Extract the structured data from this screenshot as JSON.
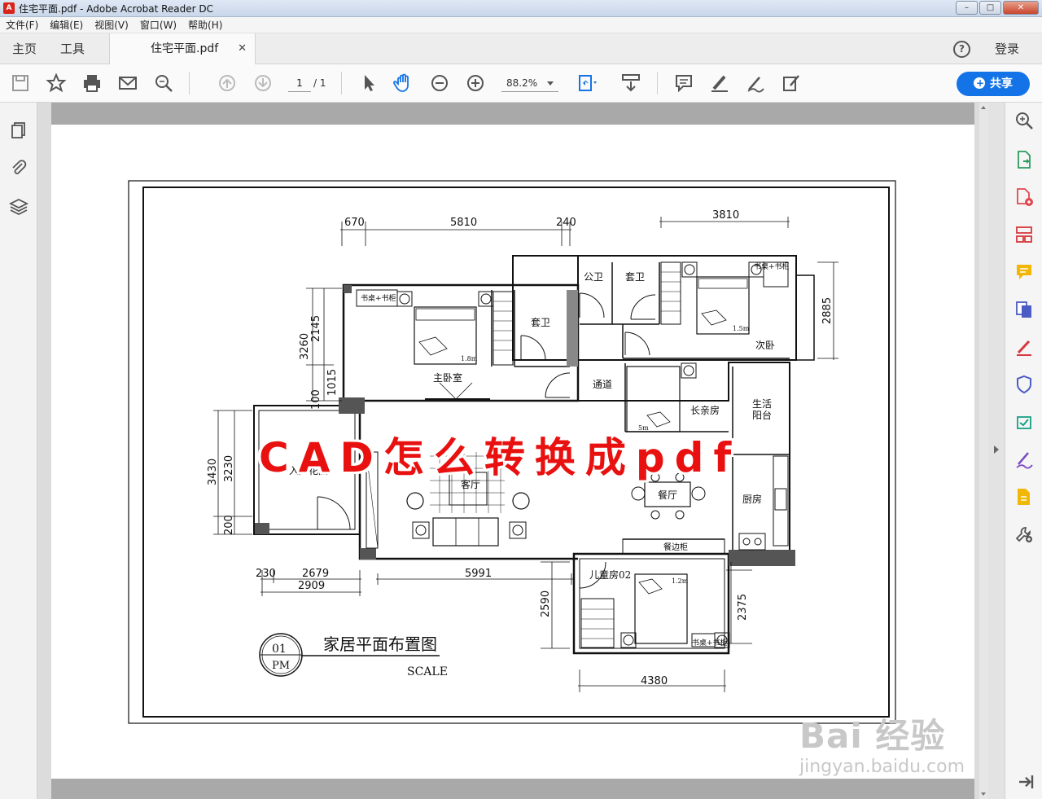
{
  "window": {
    "title": "住宅平面.pdf - Adobe Acrobat Reader DC",
    "min": "–",
    "max": "□",
    "close": "✕"
  },
  "menu": [
    "文件(F)",
    "编辑(E)",
    "视图(V)",
    "窗口(W)",
    "帮助(H)"
  ],
  "tabs": {
    "home": "主页",
    "tools": "工具",
    "document": "住宅平面.pdf",
    "close": "✕",
    "help": "?",
    "login": "登录"
  },
  "toolbar": {
    "page_current": "1",
    "page_total": "/ 1",
    "zoom": "88.2%",
    "share": "共享"
  },
  "left_icons": [
    "pages-icon",
    "attachment-icon",
    "layers-icon"
  ],
  "right_icons": [
    "zoom-icon",
    "export-pdf-icon",
    "create-pdf-icon",
    "organize-pages-icon",
    "comment-icon",
    "combine-files-icon",
    "fill-sign-icon",
    "protect-icon",
    "send-for-review-icon",
    "sign-icon",
    "edit-pdf-icon",
    "more-tools-icon"
  ],
  "drawing": {
    "title": "家居平面布置图",
    "scale": "SCALE",
    "badge_top": "01",
    "badge_bottom": "PM",
    "dims": {
      "d670": "670",
      "d5810": "5810",
      "d240": "240",
      "d3810": "3810",
      "d2885": "2885",
      "d3260": "3260",
      "d2145": "2145",
      "d1015": "1015",
      "d100": "100",
      "d3430": "3430",
      "d3230": "3230",
      "d200": "200",
      "d230": "230",
      "d2679": "2679",
      "d2909": "2909",
      "d5991": "5991",
      "d2590": "2590",
      "d2375": "2375",
      "d4380": "4380"
    },
    "rooms": {
      "gongwei": "公卫",
      "taowei1": "套卫",
      "taowei2": "套卫",
      "shuzhuo1": "书桌+书柜",
      "shuzhuo2": "书桌+书柜",
      "shuzhuo3": "书桌+书柜",
      "bed18": "1.8m",
      "bed15": "1.5m",
      "bed15b": "5m",
      "master": "主卧室",
      "second": "次卧",
      "corridor": "通道",
      "elder": "长亲房",
      "balcony1": "生活",
      "balcony2": "阳台",
      "garden": "入户花园",
      "living": "客厅",
      "dining": "餐厅",
      "kitchen": "厨房",
      "sideboard": "餐边柜",
      "child": "儿童房02",
      "bed1": "1.2m"
    }
  },
  "overlay_text": "CAD怎么转换成pdf",
  "watermark": {
    "line1": "Bai 经验",
    "line2": "jingyan.baidu.com"
  }
}
